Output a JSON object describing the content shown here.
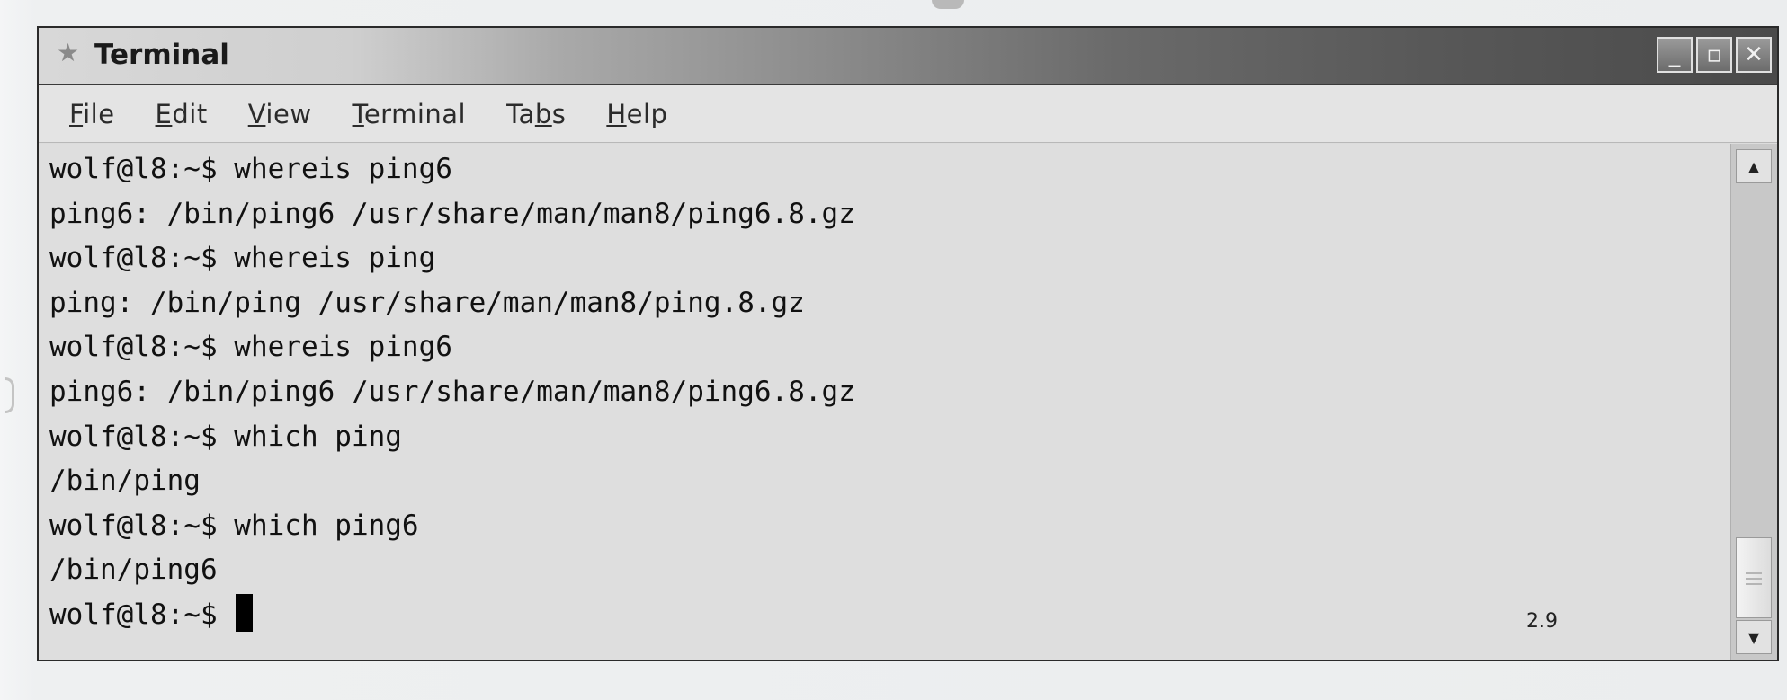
{
  "window": {
    "title": "Terminal",
    "star_icon": "star-icon",
    "controls": {
      "minimize_icon": "minimize-icon",
      "minimize_glyph": "_",
      "maximize_icon": "maximize-icon",
      "maximize_glyph": "▫",
      "close_icon": "close-icon",
      "close_glyph": "✕"
    }
  },
  "menubar": {
    "items": [
      {
        "mnemonic": "F",
        "rest": "ile"
      },
      {
        "mnemonic": "E",
        "rest": "dit"
      },
      {
        "mnemonic": "V",
        "rest": "iew"
      },
      {
        "mnemonic": "T",
        "rest": "erminal"
      },
      {
        "prefix": "Ta",
        "mnemonic": "b",
        "rest": "s"
      },
      {
        "mnemonic": "H",
        "rest": "elp"
      }
    ]
  },
  "terminal": {
    "lines": [
      "wolf@l8:~$ whereis ping6",
      "ping6: /bin/ping6 /usr/share/man/man8/ping6.8.gz",
      "wolf@l8:~$ whereis ping",
      "ping: /bin/ping /usr/share/man/man8/ping.8.gz",
      "wolf@l8:~$ whereis ping6",
      "ping6: /bin/ping6 /usr/share/man/man8/ping6.8.gz",
      "wolf@l8:~$ which ping",
      "/bin/ping",
      "wolf@l8:~$ which ping6",
      "/bin/ping6"
    ],
    "prompt": "wolf@l8:~$ "
  },
  "scrollbar": {
    "up_icon": "scroll-up-arrow-icon",
    "down_icon": "scroll-down-arrow-icon",
    "up_glyph": "▲",
    "down_glyph": "▼",
    "position": 1.0
  },
  "figure_label": "2.9"
}
